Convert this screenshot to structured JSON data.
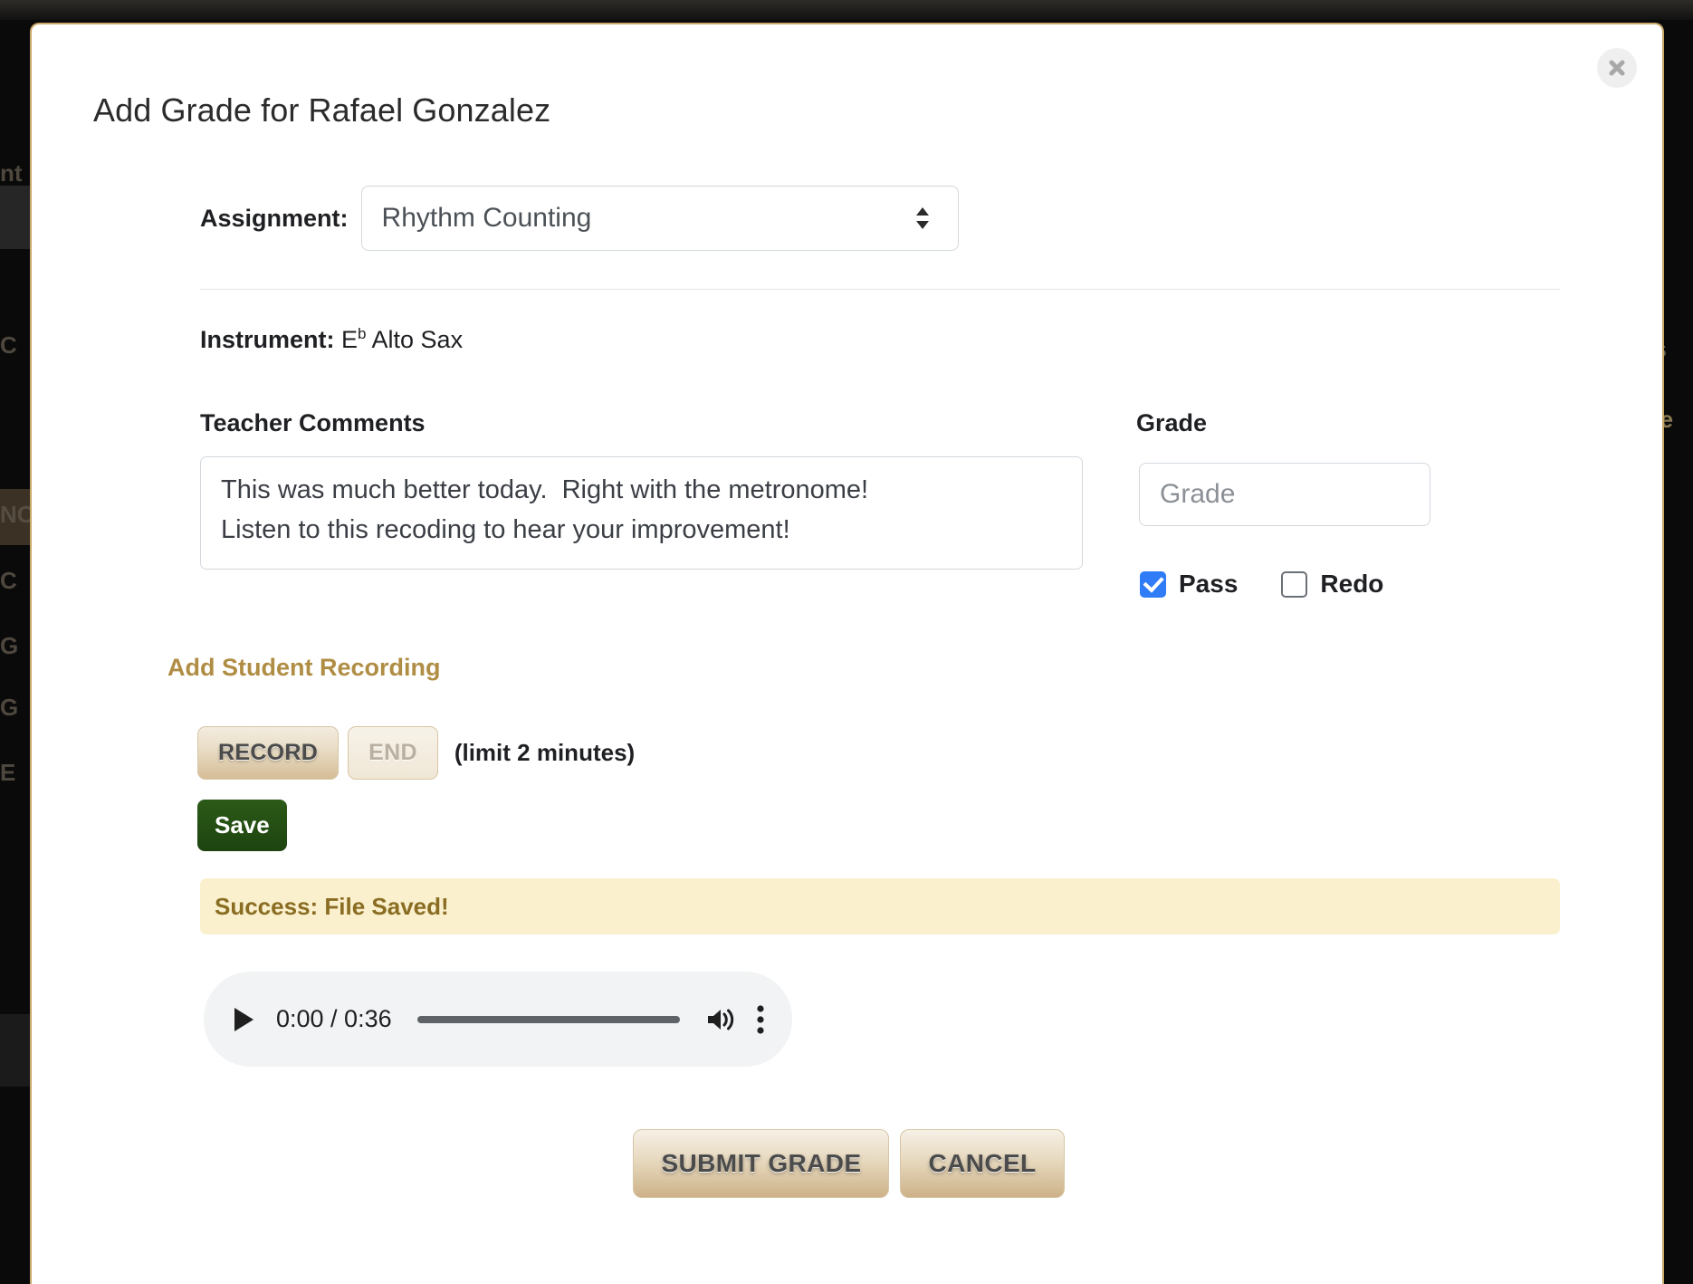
{
  "modal": {
    "title": "Add Grade for Rafael Gonzalez",
    "close_icon": "close-icon"
  },
  "assignment": {
    "label": "Assignment:",
    "selected": "Rhythm Counting",
    "caret_icon": "chevron-up-down-icon"
  },
  "instrument": {
    "label": "Instrument:",
    "note": "E",
    "accidental": "b",
    "name": " Alto Sax"
  },
  "comments": {
    "label": "Teacher Comments",
    "value": "This was much better today.  Right with the metronome!\nListen to this recoding to hear your improvement!",
    "placeholder": ""
  },
  "grade": {
    "label": "Grade",
    "value": "",
    "placeholder": "Grade",
    "checkboxes": [
      {
        "label": "Pass",
        "checked": true
      },
      {
        "label": "Redo",
        "checked": false
      }
    ],
    "checked_color": "#2f7cf6"
  },
  "recording": {
    "heading": "Add Student Recording",
    "heading_color": "#b08d44",
    "record_label": "RECORD",
    "end_label": "END",
    "end_disabled": true,
    "limit_note": "(limit 2 minutes)",
    "save_label": "Save",
    "save_color": "#1d4410",
    "alert": "Success: File Saved!",
    "alert_bg": "#faf0cd",
    "alert_color": "#8a6d23"
  },
  "audio": {
    "play_icon": "play-icon",
    "current_time": "0:00",
    "duration": "0:36",
    "time_display": "0:00 / 0:36",
    "volume_icon": "volume-high-icon",
    "menu_icon": "more-vertical-icon",
    "progress_percent": 0
  },
  "footer": {
    "submit_label": "SUBMIT GRADE",
    "cancel_label": "CANCEL"
  },
  "background": {
    "left_fragments": [
      "nt",
      "C",
      "NC",
      "C",
      "G",
      "G",
      "E"
    ],
    "right_fragments": [
      "as",
      "ele"
    ]
  },
  "theme": {
    "modal_border": "#c9a96a",
    "accent_tan": "#d5bd96",
    "backdrop": "#0a0a0a"
  }
}
